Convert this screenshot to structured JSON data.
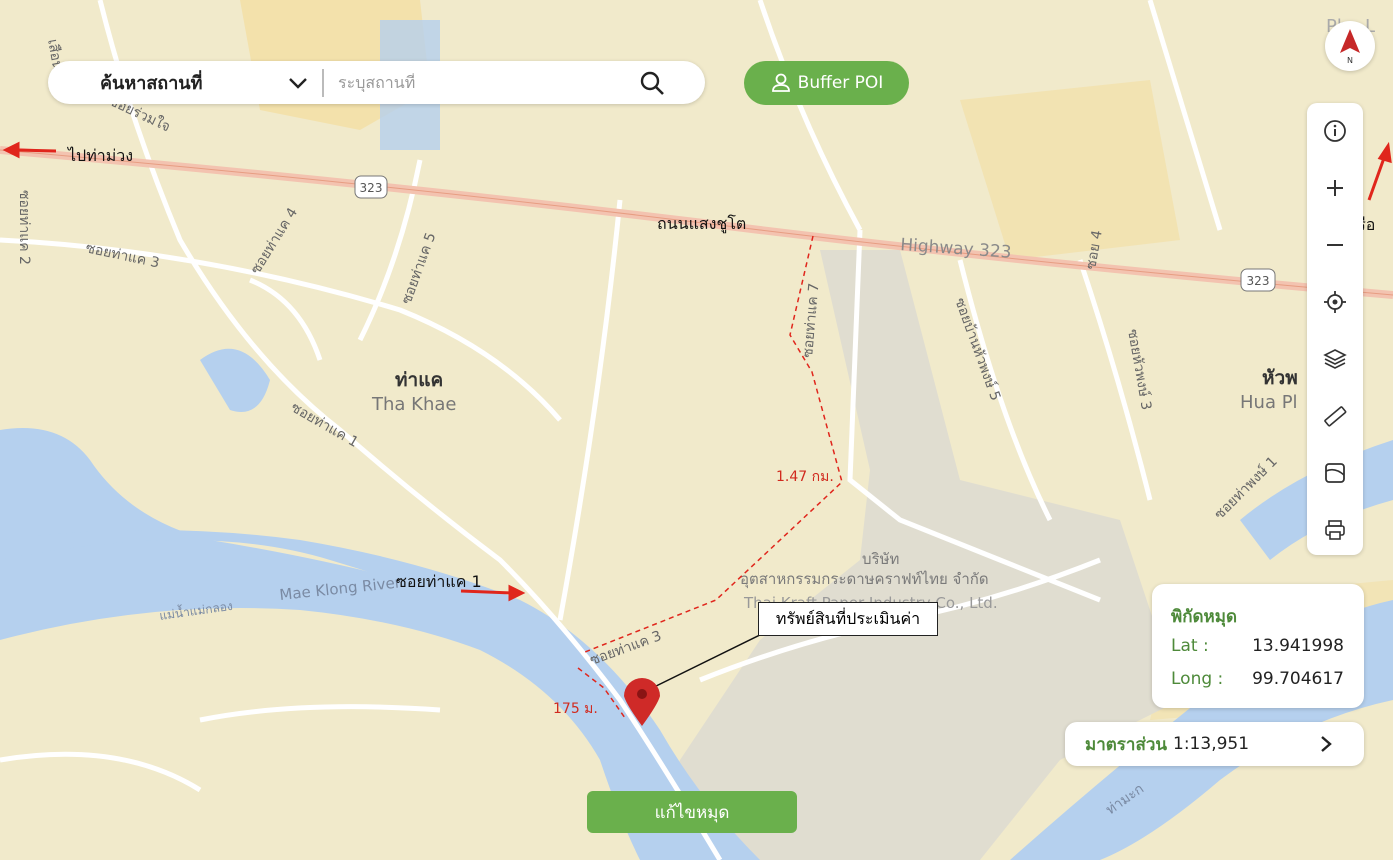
{
  "search": {
    "category": "ค้นหาสถานที่",
    "placeholder": "ระบุสถานที่"
  },
  "buffer_button": "Buffer POI",
  "compass_label": "N",
  "toolbar": [
    "info-icon",
    "zoom-in-icon",
    "zoom-out-icon",
    "locate-icon",
    "layers-icon",
    "ruler-icon",
    "map-type-icon",
    "print-icon"
  ],
  "coordinates": {
    "title": "พิกัดหมุด",
    "lat_label": "Lat :",
    "lat_value": "13.941998",
    "long_label": "Long :",
    "long_value": "99.704617"
  },
  "scale": {
    "label": "มาตราส่วน",
    "value": "1:13,951"
  },
  "edit_button": "แก้ไขหมุด",
  "annotations": {
    "to_tha_muang": "ไปท่าม่วง",
    "to_tha_ruea": "ไปท่าเรือ",
    "road_name": "ถนนแสงชูโต",
    "soi": "ซอยท่าแค 1",
    "property": "ทรัพย์สินที่ประเมินค่า",
    "dist_road": "1.47 กม.",
    "dist_soi": "175 ม."
  },
  "map_labels": {
    "tha_khae_th": "ท่าแค",
    "tha_khae_en": "Tha Khae",
    "highway": "Highway 323",
    "route_badge": "323",
    "river": "Mae Klong River",
    "river_th": "แม่น้ำแม่กลอง",
    "company_1": "บริษัท",
    "company_2": "อุตสาหกรรมกระดาษคราฟท์ไทย จำกัด",
    "company_en": "Thai Kraft Paper Industry Co., Ltd.",
    "soi_tha_khae_2": "ซอยท่าแค 2",
    "soi_tha_khae_3": "ซอยท่าแค 3",
    "soi_tha_khae_4": "ซอยท่าแค 4",
    "soi_tha_khae_5": "ซอยท่าแค 5",
    "soi_tha_khae_7": "ซอยท่าแค 7",
    "soi_tha_khae_1": "ซอยท่าแค 1",
    "soi_4": "ซอย 4",
    "soi_wang_5": "ซอยบ้านหัวพงษ์ 5",
    "soi_wang_3": "ซอยหัวพงษ์ 3",
    "soi_wang_1": "ซอยท่าพงษ์ 1",
    "hua_pho_th": "หัวพ",
    "hua_pho_en": "Hua Pl",
    "pho_lo": "Pho L",
    "soi_ruamjai": "ซอยร่วมใจ",
    "soi_lueam": "เสือน",
    "tha_ma_ka": "ท่ามะก"
  },
  "colors": {
    "land": "#f1eacb",
    "land_warm": "#f4dea2",
    "water": "#b5d0ee",
    "road": "#ffffff",
    "highway": "#f3c3b0",
    "industrial": "#e0ddd0",
    "accent_green": "#6ab04c",
    "marker_red": "#cf2a28",
    "annotation_red": "#d12a1e"
  }
}
